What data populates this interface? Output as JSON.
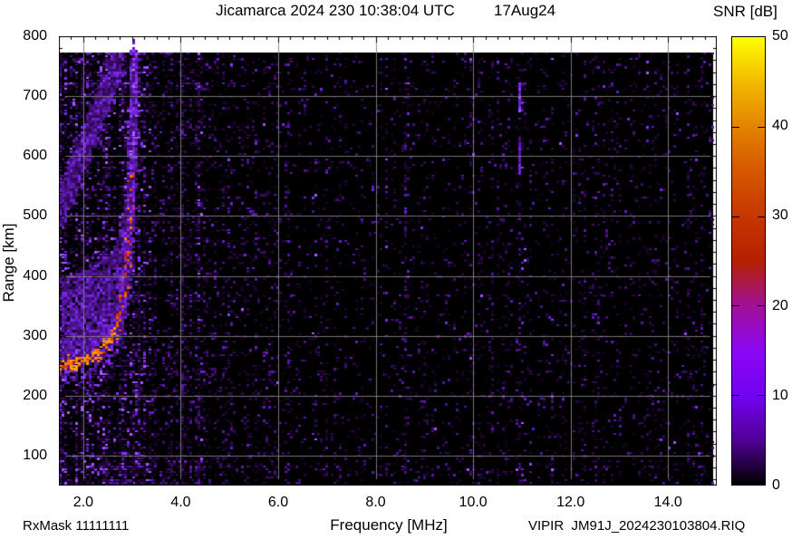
{
  "chart_data": {
    "type": "heatmap",
    "title": "Jicamarca 2024 230 10:38:04 UTC",
    "date_label": "17Aug24",
    "xlabel": "Frequency [MHz]",
    "ylabel": "Range [km]",
    "x_range": [
      1.5,
      15.0
    ],
    "y_range": [
      50,
      800
    ],
    "x_major_ticks": [
      2.0,
      4.0,
      6.0,
      8.0,
      10.0,
      12.0,
      14.0
    ],
    "x_minor_step": 0.25,
    "y_major_ticks": [
      100,
      200,
      300,
      400,
      500,
      600,
      700,
      800
    ],
    "y_grid_lines": [
      100,
      200,
      300,
      400,
      500,
      600,
      700
    ],
    "y_minor_step": 20,
    "grid": true,
    "grid_color": "#828282",
    "background_color": "#000000",
    "data_top_km": 772,
    "colorbar": {
      "label": "SNR [dB]",
      "min": 0,
      "max": 50,
      "ticks": [
        0,
        10,
        20,
        30,
        40,
        50
      ],
      "palette_stops": [
        [
          0.0,
          "#000000"
        ],
        [
          0.1,
          "#510096"
        ],
        [
          0.2,
          "#7202f2"
        ],
        [
          0.3,
          "#8c07f3"
        ],
        [
          0.4,
          "#a11096"
        ],
        [
          0.5,
          "#b52000"
        ],
        [
          0.6,
          "#c63700"
        ],
        [
          0.7,
          "#d55700"
        ],
        [
          0.8,
          "#e48300"
        ],
        [
          0.9,
          "#f2ba00"
        ],
        [
          1.0,
          "#ffff00"
        ]
      ]
    },
    "features": {
      "noise_palette_stops": [
        [
          0.0,
          "#140320"
        ],
        [
          0.3,
          "#2a0748"
        ],
        [
          0.55,
          "#421075"
        ],
        [
          0.75,
          "#5e18b8"
        ],
        [
          0.9,
          "#7c2cf0"
        ],
        [
          1.0,
          "#a55cff"
        ]
      ],
      "background_noise_bands": [
        {
          "f_range": [
            1.5,
            2.1
          ],
          "density": 0.5
        },
        {
          "f_range": [
            2.1,
            3.35
          ],
          "density": 0.46
        },
        {
          "f_range": [
            3.35,
            4.6
          ],
          "density": 0.26
        },
        {
          "f_range": [
            4.6,
            6.2
          ],
          "density": 0.16
        },
        {
          "f_range": [
            6.2,
            15.0
          ],
          "density": 0.1
        }
      ],
      "bottom_row_boost": {
        "r_max": 90,
        "gain": 1.5
      },
      "striation_columns": [
        {
          "f": 4.35,
          "hw": 0.06,
          "gain": 1.7
        },
        {
          "f": 5.0,
          "hw": 0.05,
          "gain": 1.4
        },
        {
          "f": 6.7,
          "hw": 0.06,
          "gain": 2.0
        },
        {
          "f": 8.2,
          "hw": 0.05,
          "gain": 1.7
        },
        {
          "f": 8.6,
          "hw": 0.05,
          "gain": 1.5
        },
        {
          "f": 9.9,
          "hw": 0.05,
          "gain": 1.5
        },
        {
          "f": 11.0,
          "hw": 0.05,
          "gain": 1.6
        },
        {
          "f": 11.6,
          "hw": 0.05,
          "gain": 1.7
        },
        {
          "f": 12.5,
          "hw": 0.05,
          "gain": 1.4
        },
        {
          "f": 13.5,
          "hw": 0.05,
          "gain": 1.6
        }
      ],
      "spread_band": {
        "from": [
          1.5,
          505
        ],
        "to": [
          2.78,
          772
        ],
        "sigma_km": 40,
        "sigma_mhz": 0.12,
        "points": 2600
      },
      "trace_cloud": {
        "f_range": [
          1.55,
          3.25
        ],
        "r_offset": [
          10,
          150
        ],
        "points": 2200
      },
      "echo_trace": {
        "points": [
          [
            1.5,
            247
          ],
          [
            1.7,
            251
          ],
          [
            1.9,
            256
          ],
          [
            2.1,
            262
          ],
          [
            2.3,
            271
          ],
          [
            2.5,
            284
          ],
          [
            2.65,
            302
          ],
          [
            2.75,
            326
          ],
          [
            2.85,
            372
          ],
          [
            2.92,
            432
          ],
          [
            2.97,
            512
          ],
          [
            3.01,
            600
          ],
          [
            3.04,
            700
          ],
          [
            3.06,
            772
          ]
        ],
        "core_colors_by_range": [
          {
            "r_max": 310,
            "colors": [
              "#ffa200",
              "#ff6c00",
              "#ff8c1a",
              "#e03800"
            ]
          },
          {
            "r_max": 450,
            "colors": [
              "#ff5e00",
              "#d63000",
              "#e85500",
              "#c02060"
            ]
          },
          {
            "r_max": 580,
            "colors": [
              "#d64000",
              "#c02890",
              "#9a30e0",
              "#ff7a00"
            ]
          },
          {
            "r_max": 9999,
            "colors": [
              "#8a2be2",
              "#9a4dff",
              "#7a22d8",
              "#b06aff"
            ]
          }
        ]
      },
      "rfi_streaks": [
        {
          "f": 10.93,
          "range_km": [
            675,
            722
          ],
          "brightness": 1.0
        },
        {
          "f": 10.93,
          "range_km": [
            572,
            622
          ],
          "brightness": 0.9
        }
      ]
    },
    "annotations": {
      "rx_mask": "RxMask 11111111",
      "file_label": "VIPIR  JM91J_2024230103804.RIQ"
    }
  }
}
